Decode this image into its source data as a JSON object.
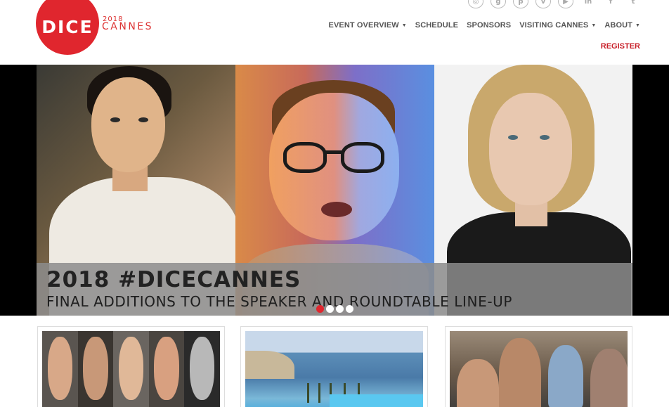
{
  "brand": {
    "logo_text": "DICE",
    "year": "2018",
    "city": "CANNES",
    "brand_color": "#e0262e"
  },
  "social": [
    {
      "icon": "instagram-icon",
      "glyph": "◎"
    },
    {
      "icon": "google-plus-icon",
      "glyph": "g"
    },
    {
      "icon": "pinterest-icon",
      "glyph": "p"
    },
    {
      "icon": "vine-icon",
      "glyph": "v"
    },
    {
      "icon": "youtube-icon",
      "glyph": "▶"
    },
    {
      "icon": "linkedin-icon",
      "glyph": "in"
    },
    {
      "icon": "facebook-icon",
      "glyph": "f"
    },
    {
      "icon": "twitter-icon",
      "glyph": "t"
    }
  ],
  "nav": {
    "items": [
      {
        "label": "EVENT OVERVIEW",
        "dropdown": true
      },
      {
        "label": "SCHEDULE",
        "dropdown": false
      },
      {
        "label": "SPONSORS",
        "dropdown": false
      },
      {
        "label": "VISITING CANNES",
        "dropdown": true
      },
      {
        "label": "ABOUT",
        "dropdown": true
      }
    ],
    "register_label": "REGISTER"
  },
  "hero": {
    "title": "2018 #DICECANNES",
    "subtitle": "FINAL ADDITIONS TO THE SPEAKER AND ROUNDTABLE LINE-UP",
    "slide_count": 4,
    "active_slide": 1
  }
}
